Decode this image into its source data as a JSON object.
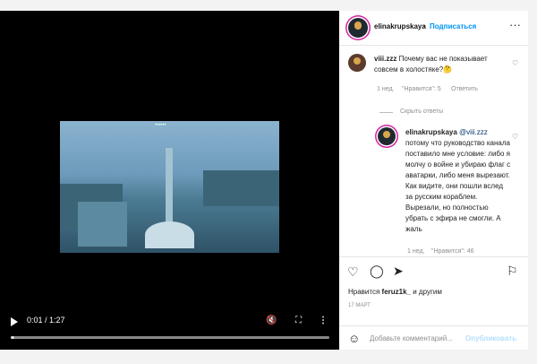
{
  "video": {
    "time": "0:01 / 1:27",
    "progress": 0.012,
    "watermark_text": "••••••"
  },
  "header": {
    "username": "elinakrupskaya",
    "separator": "•",
    "follow_label": "Подписаться",
    "more_glyph": "···"
  },
  "comment1": {
    "username": "viii.zzz",
    "text": "Почему вас не показывает совсем в холостяке?🤔",
    "time": "1 нед.",
    "likes": "\"Нравится\": 5",
    "reply": "Ответить",
    "hide_replies": "Скрыть ответы"
  },
  "reply1": {
    "username": "elinakrupskaya",
    "mention": "@viii.zzz",
    "text": "потому что руководство канала поставило мне условие: либо я молчу о войне и убираю флаг с аватарки, либо меня вырезают. Как видите, они пошли вслед за русским кораблем. Вырезали, но полностью убрать с эфира не смогли. А жаль",
    "time": "1 нед.",
    "likes": "\"Нравится\": 46"
  },
  "actions": {
    "liked_by_prefix": "Нравится ",
    "liked_by_user": "feruz1k_",
    "liked_by_suffix": " и другим",
    "date": "17 МАРТ"
  },
  "add_comment": {
    "placeholder": "Добавьте комментарий...",
    "publish_label": "Опубликовать"
  },
  "colors": {
    "accent": "#0095f6",
    "publish_disabled": "#b2dffc"
  }
}
